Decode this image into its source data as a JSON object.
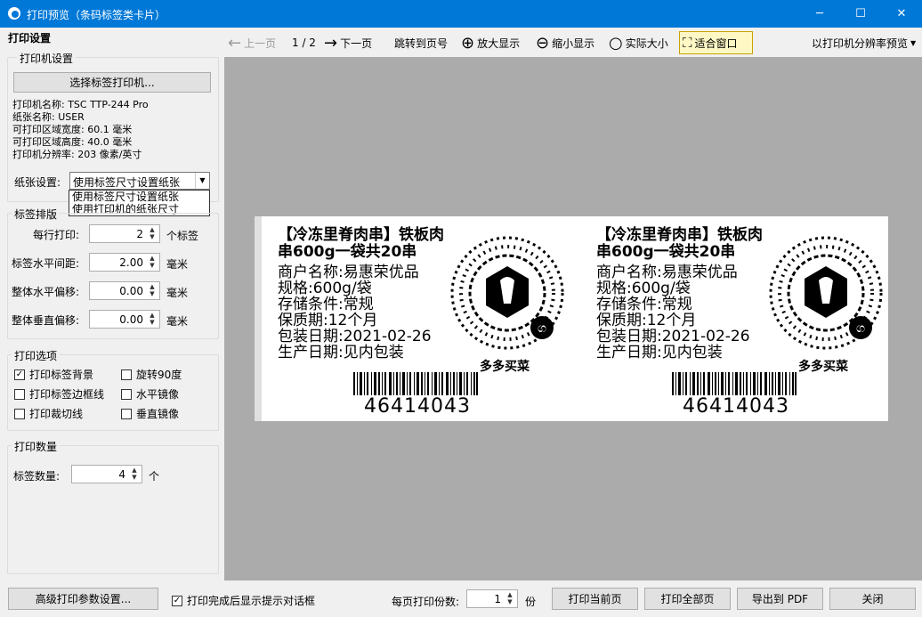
{
  "window": {
    "title": "打印预览（条码标签类卡片）",
    "minimize": "─",
    "maximize": "☐",
    "close": "✕"
  },
  "sidebar": {
    "heading": "打印设置",
    "printer_group": {
      "title": "打印机设置",
      "select_button": "选择标签打印机...",
      "info": [
        "打印机名称: TSC TTP-244 Pro",
        "纸张名称: USER",
        "可打印区域宽度: 60.1 毫米",
        "可打印区域高度: 40.0 毫米",
        "打印机分辨率: 203 像素/英寸"
      ],
      "paper_label": "纸张设置:",
      "paper_value": "使用标签尺寸设置纸张",
      "paper_options": [
        "使用标签尺寸设置纸张",
        "使用打印机的纸张尺寸"
      ]
    },
    "layout_group": {
      "title": "标签排版",
      "per_row_label": "每行打印:",
      "per_row_value": "2",
      "per_row_unit": "个标签",
      "h_gap_label": "标签水平间距:",
      "h_gap_value": "2.00",
      "h_gap_unit": "毫米",
      "h_offset_label": "整体水平偏移:",
      "h_offset_value": "0.00",
      "h_offset_unit": "毫米",
      "v_offset_label": "整体垂直偏移:",
      "v_offset_value": "0.00",
      "v_offset_unit": "毫米"
    },
    "options_group": {
      "title": "打印选项",
      "print_bg": "打印标签背景",
      "print_bg_checked": true,
      "rotate90": "旋转90度",
      "rotate90_checked": false,
      "print_border": "打印标签边框线",
      "print_border_checked": false,
      "h_mirror": "水平镜像",
      "h_mirror_checked": false,
      "print_cut": "打印裁切线",
      "print_cut_checked": false,
      "v_mirror": "垂直镜像",
      "v_mirror_checked": false
    },
    "count_group": {
      "title": "打印数量",
      "label": "标签数量:",
      "value": "4",
      "unit": "个"
    }
  },
  "toolbar": {
    "prev": "上一页",
    "page_indicator": "1 / 2",
    "next": "下一页",
    "jump": "跳转到页号",
    "zoom_in": "放大显示",
    "zoom_out": "缩小显示",
    "actual_size": "实际大小",
    "fit_window": "适合窗口",
    "resolution_preview": "以打印机分辨率预览"
  },
  "label": {
    "title_line1": "【冷冻里脊肉串】铁板肉",
    "title_line2": "串600g一袋共20串",
    "merchant": "商户名称:易惠荣优品",
    "spec": "规格:600g/袋",
    "storage": "存储条件:常规",
    "shelf_life": "保质期:12个月",
    "pack_date": "包装日期:2021-02-26",
    "prod_date": "生产日期:见内包装",
    "qr_name": "多多买菜",
    "barcode_number": "46414043"
  },
  "bottom": {
    "advanced_button": "高级打印参数设置...",
    "show_dialog_label": "打印完成后显示提示对话框",
    "show_dialog_checked": true,
    "copies_label": "每页打印份数:",
    "copies_value": "1",
    "copies_unit": "份",
    "print_current": "打印当前页",
    "print_all": "打印全部页",
    "export_pdf": "导出到 PDF",
    "close": "关闭"
  }
}
